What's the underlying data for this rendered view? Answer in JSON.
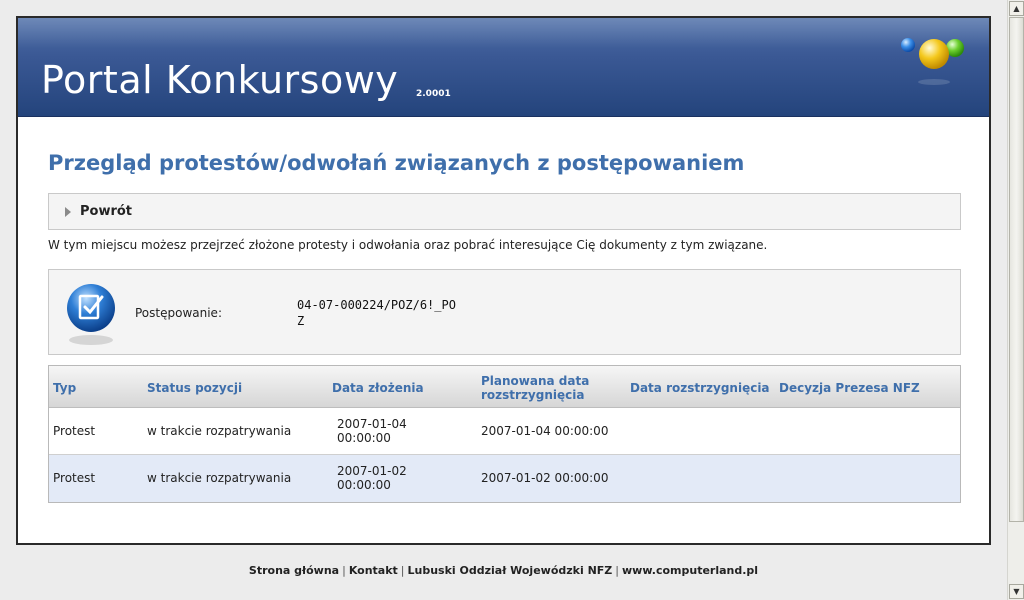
{
  "header": {
    "title": "Portal Konkursowy",
    "version": "2.0001"
  },
  "page": {
    "heading": "Przegląd protestów/odwołań związanych z postępowaniem",
    "back_label": "Powrót",
    "info_text": "W tym miejscu możesz przejrzeć złożone protesty i odwołania oraz pobrać interesujące Cię dokumenty z tym związane."
  },
  "procedure": {
    "label": "Postępowanie:",
    "value": "04-07-000224/POZ/6!_POZ"
  },
  "table": {
    "columns": [
      "Typ",
      "Status pozycji",
      "Data złożenia",
      "Planowana data rozstrzygnięcia",
      "Data rozstrzygnięcia",
      "Decyzja Prezesa NFZ"
    ],
    "rows": [
      {
        "typ": "Protest",
        "status": "w trakcie rozpatrywania",
        "data_zlozenia": "2007-01-04 00:00:00",
        "planowana": "2007-01-04 00:00:00",
        "data_rozstrzygniecia": "",
        "decyzja": ""
      },
      {
        "typ": "Protest",
        "status": "w trakcie rozpatrywania",
        "data_zlozenia": "2007-01-02 00:00:00",
        "planowana": "2007-01-02 00:00:00",
        "data_rozstrzygniecia": "",
        "decyzja": ""
      }
    ]
  },
  "footer": {
    "links": [
      "Strona główna",
      "Kontakt",
      "Lubuski Oddział Wojewódzki NFZ",
      "www.computerland.pl"
    ]
  },
  "icons": {
    "back": "triangle-right-icon",
    "procedure": "document-check-icon",
    "logo": "colored-spheres-logo-icon"
  },
  "colors": {
    "header_blue": "#2e4d88",
    "heading_blue": "#3f6fab",
    "row_alt": "#e3eaf7"
  }
}
